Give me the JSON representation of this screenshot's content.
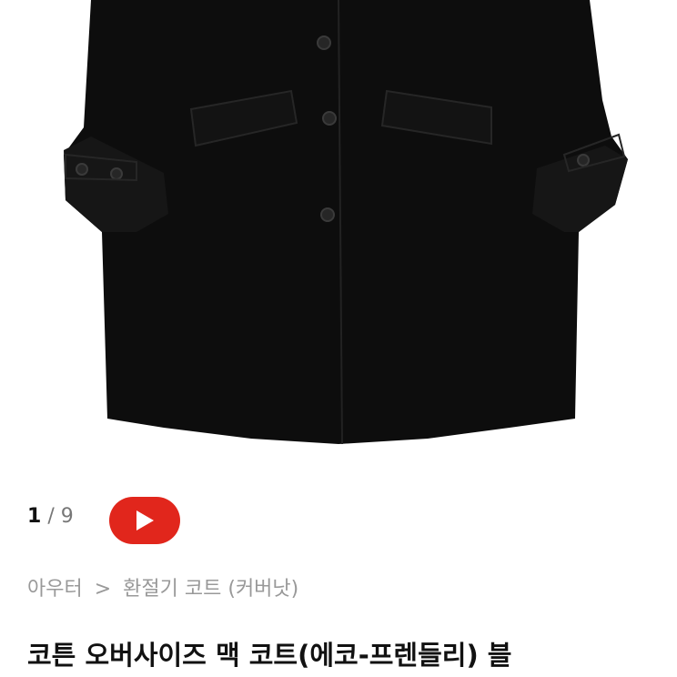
{
  "gallery": {
    "current": "1",
    "separator": "/",
    "total": "9",
    "image_alt": "black coat"
  },
  "video_button": {
    "label": "play-video",
    "color": "#e1261c"
  },
  "breadcrumb": {
    "category": "아우터",
    "separator": ">",
    "subcategory": "환절기 코트 (커버낫)"
  },
  "product": {
    "title": "코튼 오버사이즈 맥 코트(에코-프렌들리) 블"
  },
  "colors": {
    "accent": "#e1261c",
    "muted": "#999999"
  }
}
